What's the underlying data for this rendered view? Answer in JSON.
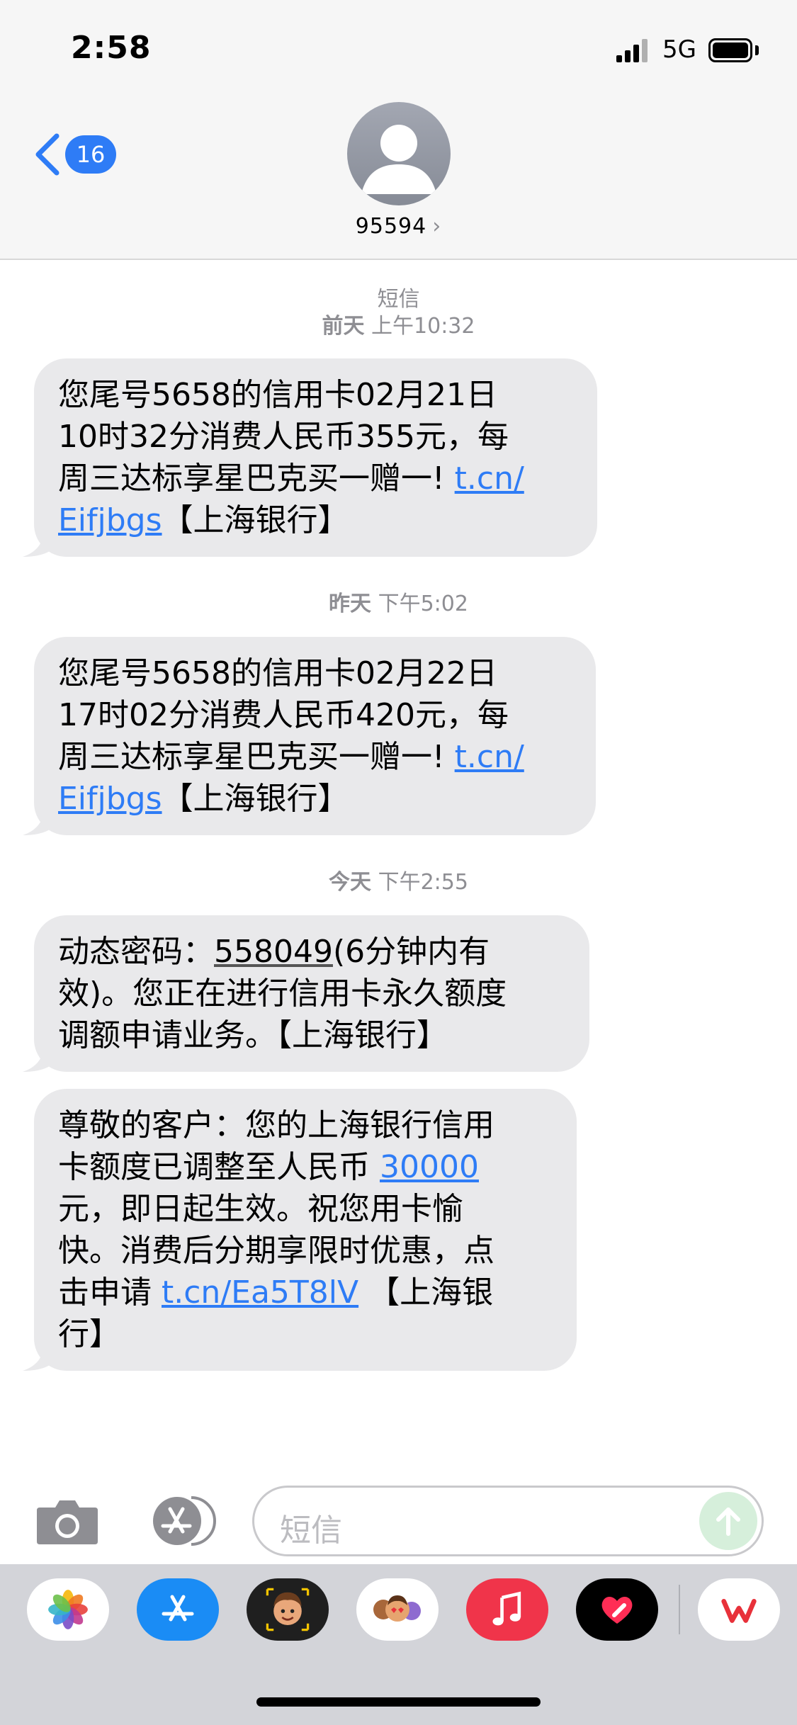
{
  "status_bar": {
    "time": "2:58",
    "network": "5G",
    "battery_fraction": 1.0
  },
  "nav": {
    "unread_count": "16",
    "contact_name": "95594",
    "contact_chevron": "›",
    "back_icon": "chevron-left-icon",
    "avatar_icon": "person-avatar-icon"
  },
  "thread": {
    "channel_label": "短信",
    "groups": [
      {
        "day": "前天",
        "time": "上午10:32",
        "lines": [
          "您尾号5658的信用卡02月21日",
          "10时32分消费人民币355元，每",
          "周三达标享星巴克买一赠一!"
        ],
        "link_a": "t.cn/",
        "link_b": "Eifjbgs",
        "suffix": "【上海银行】"
      },
      {
        "day": "昨天",
        "time": "下午5:02",
        "lines": [
          "您尾号5658的信用卡02月22日",
          "17时02分消费人民币420元，每",
          "周三达标享星巴克买一赠一!"
        ],
        "link_a": "t.cn/",
        "link_b": "Eifjbgs",
        "suffix": "【上海银行】"
      },
      {
        "day": "今天",
        "time": "下午2:55",
        "otp_prefix": "动态密码：",
        "otp_code": "558049",
        "otp_rest": "(6分钟内有",
        "otp_lines": [
          "效)。您正在进行信用卡永久额度",
          "调额申请业务。【上海银行】"
        ],
        "limit_lines": [
          "尊敬的客户：您的上海银行信用",
          "卡额度已调整至人民币"
        ],
        "limit_amount": "30000",
        "limit_more": [
          "元，即日起生效。祝您用卡愉",
          "快。消费后分期享限时优惠，点"
        ],
        "apply_prefix": "击申请",
        "apply_link": "t.cn/Ea5T8lV",
        "apply_suffix": "【上海银",
        "apply_end": "行】"
      }
    ]
  },
  "compose": {
    "placeholder": "短信",
    "camera_icon": "camera-icon",
    "apps_icon": "app-store-icon",
    "send_icon": "send-arrow-up-icon"
  },
  "app_drawer": {
    "apps": [
      {
        "name": "photos-icon",
        "color": "#ffffff"
      },
      {
        "name": "app-store-icon",
        "color": "#1a8cf5"
      },
      {
        "name": "memoji-icon",
        "color": "#1f1f1f"
      },
      {
        "name": "animoji-stickers-icon",
        "color": "#ffffff"
      },
      {
        "name": "music-icon",
        "color": "#f0344a"
      },
      {
        "name": "digital-touch-icon",
        "color": "#000000"
      },
      {
        "name": "wps-office-icon",
        "color": "#ffffff"
      }
    ]
  }
}
